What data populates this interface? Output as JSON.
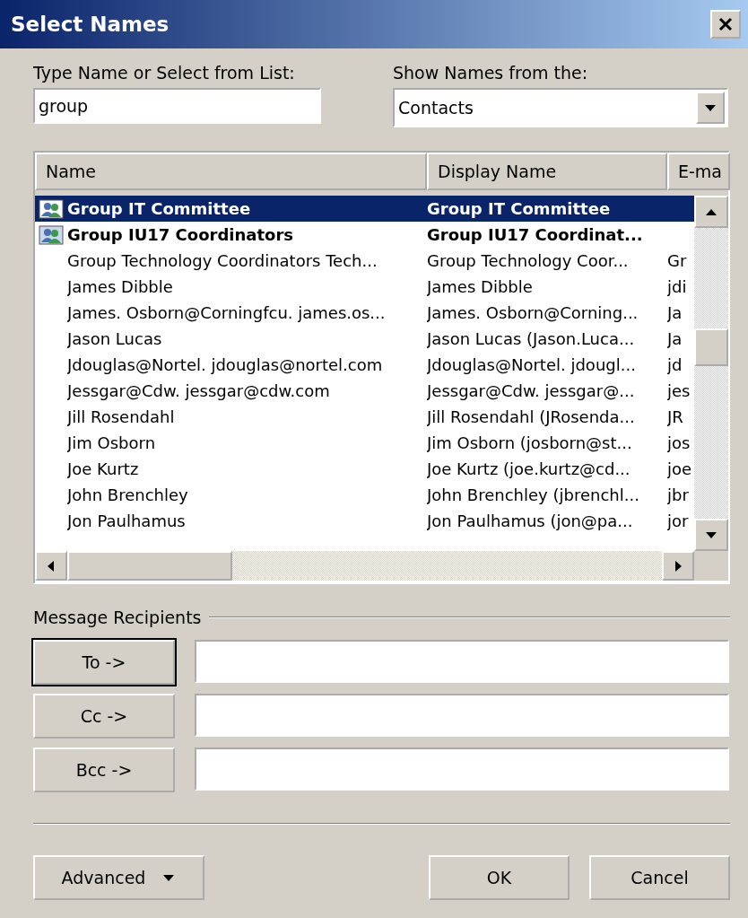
{
  "window": {
    "title": "Select Names"
  },
  "search": {
    "label": "Type Name or Select from List:",
    "value": "group"
  },
  "source": {
    "label": "Show Names from the:",
    "value": "Contacts"
  },
  "table": {
    "columns": [
      "Name",
      "Display Name",
      "E-ma"
    ],
    "rows": [
      {
        "kind": "group",
        "selected": true,
        "cells": [
          "Group IT Committee",
          "Group IT Committee",
          ""
        ]
      },
      {
        "kind": "group",
        "selected": false,
        "cells": [
          "Group IU17 Coordinators",
          "Group IU17 Coordinat...",
          ""
        ]
      },
      {
        "kind": "contact",
        "selected": false,
        "cells": [
          "Group Technology Coordinators Tech...",
          "Group Technology Coor...",
          "Gr"
        ]
      },
      {
        "kind": "contact",
        "selected": false,
        "cells": [
          "James Dibble",
          "James Dibble",
          "jdi"
        ]
      },
      {
        "kind": "contact",
        "selected": false,
        "cells": [
          "James. Osborn@Corningfcu. james.os...",
          "James. Osborn@Corning...",
          "Ja"
        ]
      },
      {
        "kind": "contact",
        "selected": false,
        "cells": [
          "Jason Lucas",
          "Jason Lucas (Jason.Luca...",
          "Ja"
        ]
      },
      {
        "kind": "contact",
        "selected": false,
        "cells": [
          "Jdouglas@Nortel. jdouglas@nortel.com",
          "Jdouglas@Nortel. jdougl...",
          "jd"
        ]
      },
      {
        "kind": "contact",
        "selected": false,
        "cells": [
          "Jessgar@Cdw. jessgar@cdw.com",
          "Jessgar@Cdw. jessgar@...",
          "jes"
        ]
      },
      {
        "kind": "contact",
        "selected": false,
        "cells": [
          "Jill Rosendahl",
          "Jill Rosendahl (JRosenda...",
          "JR"
        ]
      },
      {
        "kind": "contact",
        "selected": false,
        "cells": [
          "Jim Osborn",
          "Jim Osborn (josborn@st...",
          "jos"
        ]
      },
      {
        "kind": "contact",
        "selected": false,
        "cells": [
          "Joe Kurtz",
          "Joe Kurtz (joe.kurtz@cd...",
          "joe"
        ]
      },
      {
        "kind": "contact",
        "selected": false,
        "cells": [
          "John Brenchley",
          "John Brenchley (jbrenchl...",
          "jbr"
        ]
      },
      {
        "kind": "contact",
        "selected": false,
        "cells": [
          "Jon Paulhamus",
          "Jon Paulhamus (jon@pa...",
          "jor"
        ]
      }
    ]
  },
  "recipients": {
    "title": "Message Recipients",
    "buttons": [
      {
        "label": "To ->",
        "default": true
      },
      {
        "label": "Cc ->",
        "default": false
      },
      {
        "label": "Bcc ->",
        "default": false
      }
    ]
  },
  "buttons": {
    "advanced": "Advanced",
    "ok": "OK",
    "cancel": "Cancel"
  }
}
